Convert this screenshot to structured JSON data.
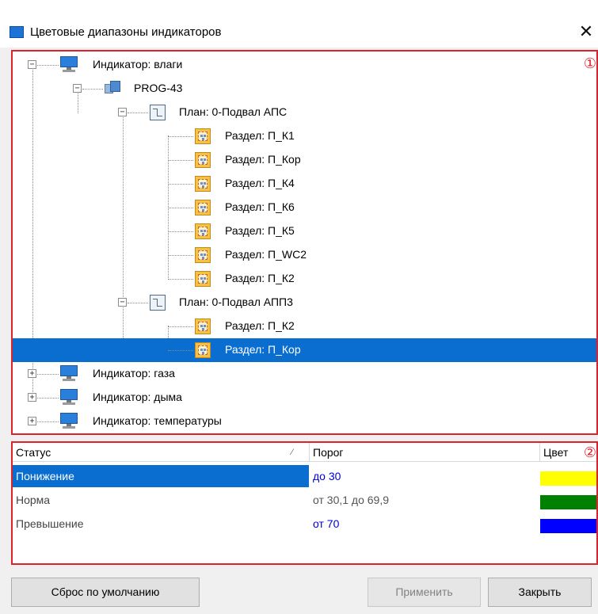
{
  "window": {
    "title": "Цветовые диапазоны индикаторов",
    "close_glyph": "✕"
  },
  "tree": {
    "marker": "①",
    "rows": [
      {
        "label": "Индикатор: влаги",
        "icon": "monitor-icon",
        "expander": "−"
      },
      {
        "label": "PROG-43",
        "icon": "prog-icon",
        "expander": "−"
      },
      {
        "label": "План: 0-Подвал АПС",
        "icon": "plan-icon",
        "expander": "−"
      },
      {
        "label": "Раздел: П_К1",
        "icon": "section-icon"
      },
      {
        "label": "Раздел: П_Кор",
        "icon": "section-icon"
      },
      {
        "label": "Раздел: П_К4",
        "icon": "section-icon"
      },
      {
        "label": "Раздел: П_К6",
        "icon": "section-icon"
      },
      {
        "label": "Раздел: П_К5",
        "icon": "section-icon"
      },
      {
        "label": "Раздел: П_WC2",
        "icon": "section-icon"
      },
      {
        "label": "Раздел: П_К2",
        "icon": "section-icon"
      },
      {
        "label": "План: 0-Подвал АПП3",
        "icon": "plan-icon",
        "expander": "−"
      },
      {
        "label": "Раздел: П_К2",
        "icon": "section-icon"
      },
      {
        "label": "Раздел: П_Кор",
        "icon": "section-icon",
        "selected": true
      },
      {
        "label": "Индикатор: газа",
        "icon": "monitor-icon",
        "expander": "+"
      },
      {
        "label": "Индикатор: дыма",
        "icon": "monitor-icon",
        "expander": "+"
      },
      {
        "label": "Индикатор: температуры",
        "icon": "monitor-icon",
        "expander": "+"
      }
    ]
  },
  "table": {
    "marker": "②",
    "headers": {
      "status": "Статус",
      "threshold": "Порог",
      "color": "Цвет",
      "sort_glyph": "⁄"
    },
    "rows": [
      {
        "status": "Понижение",
        "threshold": "до 30",
        "color": "#ffff00",
        "threshold_color": "#0000cc",
        "selected": true
      },
      {
        "status": "Норма",
        "threshold": "от 30,1 до 69,9",
        "color": "#008000",
        "threshold_color": "#555555"
      },
      {
        "status": "Превышение",
        "threshold": "от 70",
        "color": "#0000ff",
        "threshold_color": "#0000cc"
      }
    ]
  },
  "buttons": {
    "reset": "Сброс по умолчанию",
    "apply": "Применить",
    "close": "Закрыть"
  }
}
